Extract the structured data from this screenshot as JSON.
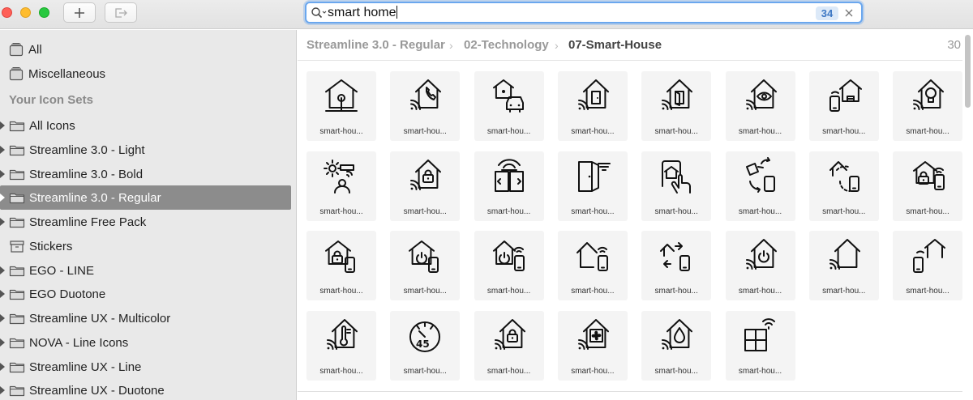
{
  "toolbar": {
    "add_icon": "plus-icon",
    "export_icon": "export-icon"
  },
  "search": {
    "value": "smart home",
    "count": "34"
  },
  "sidebar": {
    "top_items": [
      {
        "label": "All",
        "icon": "stack-icon"
      },
      {
        "label": "Miscellaneous",
        "icon": "stack-icon"
      }
    ],
    "section_header": "Your Icon Sets",
    "sets": [
      {
        "label": "All Icons",
        "icon": "folder-icon",
        "selected": false
      },
      {
        "label": "Streamline 3.0 - Light",
        "icon": "folder-icon",
        "selected": false
      },
      {
        "label": "Streamline 3.0 - Bold",
        "icon": "folder-icon",
        "selected": false
      },
      {
        "label": "Streamline 3.0 - Regular",
        "icon": "folder-icon",
        "selected": true
      },
      {
        "label": "Streamline Free Pack",
        "icon": "folder-icon",
        "selected": false
      },
      {
        "label": "Stickers",
        "icon": "archive-box-icon",
        "selected": false
      },
      {
        "label": "EGO - LINE",
        "icon": "folder-icon",
        "selected": false
      },
      {
        "label": "EGO Duotone",
        "icon": "folder-icon",
        "selected": false
      },
      {
        "label": "Streamline UX - Multicolor",
        "icon": "folder-icon",
        "selected": false
      },
      {
        "label": "NOVA - Line Icons",
        "icon": "folder-icon",
        "selected": false
      },
      {
        "label": "Streamline UX - Line",
        "icon": "folder-icon",
        "selected": false
      },
      {
        "label": "Streamline UX - Duotone",
        "icon": "folder-icon",
        "selected": false
      }
    ]
  },
  "breadcrumb": {
    "items": [
      "Streamline 3.0 - Regular",
      "02-Technology",
      "07-Smart-House"
    ],
    "count": "30"
  },
  "icons": [
    {
      "caption": "smart-hou...",
      "icon": "smart-house-icon"
    },
    {
      "caption": "smart-hou...",
      "icon": "smart-house-phone-wifi-icon"
    },
    {
      "caption": "smart-hou...",
      "icon": "smart-house-garage-car-icon"
    },
    {
      "caption": "smart-hou...",
      "icon": "smart-house-door-wifi-icon"
    },
    {
      "caption": "smart-hou...",
      "icon": "smart-house-door-open-wifi-icon"
    },
    {
      "caption": "smart-hou...",
      "icon": "smart-house-eye-wifi-icon"
    },
    {
      "caption": "smart-hou...",
      "icon": "smart-house-phone-garage-icon"
    },
    {
      "caption": "smart-hou...",
      "icon": "smart-house-light-bulb-icon"
    },
    {
      "caption": "smart-hou...",
      "icon": "smart-house-sensor-person-icon"
    },
    {
      "caption": "smart-hou...",
      "icon": "smart-house-lock-wifi-icon"
    },
    {
      "caption": "smart-hou...",
      "icon": "smart-house-door-code-icon"
    },
    {
      "caption": "smart-hou...",
      "icon": "smart-house-door-signal-icon"
    },
    {
      "caption": "smart-hou...",
      "icon": "smart-house-touch-icon"
    },
    {
      "caption": "smart-hou...",
      "icon": "smart-house-camera-sync-icon"
    },
    {
      "caption": "smart-hou...",
      "icon": "smart-house-phone-sync-icon"
    },
    {
      "caption": "smart-hou...",
      "icon": "smart-house-lock-phone-signal-icon"
    },
    {
      "caption": "smart-hou...",
      "icon": "smart-house-lock-phone-icon"
    },
    {
      "caption": "smart-hou...",
      "icon": "smart-house-power-phone-icon"
    },
    {
      "caption": "smart-hou...",
      "icon": "smart-house-power-phone-signal-icon"
    },
    {
      "caption": "smart-hou...",
      "icon": "smart-house-phone-signal-icon"
    },
    {
      "caption": "smart-hou...",
      "icon": "smart-house-phone-arrows-icon"
    },
    {
      "caption": "smart-hou...",
      "icon": "smart-house-power-wifi-icon"
    },
    {
      "caption": "smart-hou...",
      "icon": "smart-house-wifi-icon"
    },
    {
      "caption": "smart-hou...",
      "icon": "smart-house-phone-outline-icon"
    },
    {
      "caption": "smart-hou...",
      "icon": "smart-house-temperature-wifi-icon"
    },
    {
      "caption": "smart-hou...",
      "icon": "smart-house-timer-45-icon"
    },
    {
      "caption": "smart-hou...",
      "icon": "smart-house-padlock-wifi-icon"
    },
    {
      "caption": "smart-hou...",
      "icon": "smart-house-fan-wifi-icon"
    },
    {
      "caption": "smart-hou...",
      "icon": "smart-house-water-wifi-icon"
    },
    {
      "caption": "smart-hou...",
      "icon": "smart-house-window-signal-icon"
    }
  ],
  "timer_label": "45",
  "colors": {
    "selected_row": "#8c8c8c",
    "search_focus": "#6aa7ee",
    "count_badge_bg": "#dce9f8",
    "count_badge_text": "#3e78c4"
  }
}
